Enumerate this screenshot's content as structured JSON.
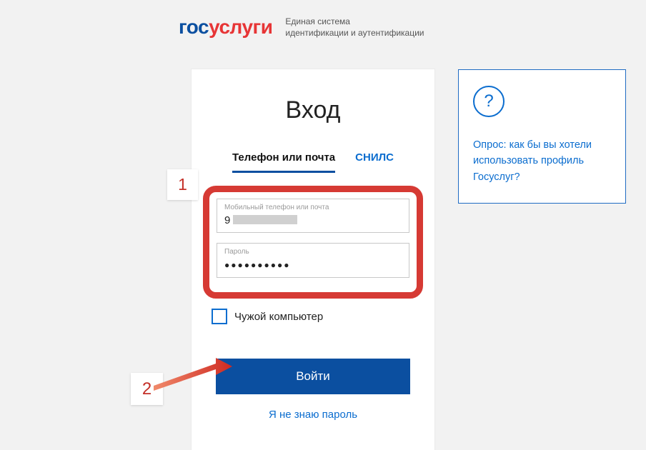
{
  "header": {
    "logo_part1": "гос",
    "logo_part2": "услуги",
    "subtitle_line1": "Единая система",
    "subtitle_line2": "идентификации и аутентификации"
  },
  "login": {
    "title": "Вход",
    "tab_phone_email": "Телефон или почта",
    "tab_snils": "СНИЛС",
    "field_login_label": "Мобильный телефон или почта",
    "field_login_value": "9",
    "field_password_label": "Пароль",
    "field_password_value": "●●●●●●●●●●",
    "checkbox_label": "Чужой компьютер",
    "submit": "Войти",
    "forgot": "Я не знаю пароль"
  },
  "help": {
    "icon_glyph": "?",
    "text": "Опрос: как бы вы хотели использовать профиль Госуслуг?"
  },
  "annotations": {
    "step1": "1",
    "step2": "2"
  }
}
